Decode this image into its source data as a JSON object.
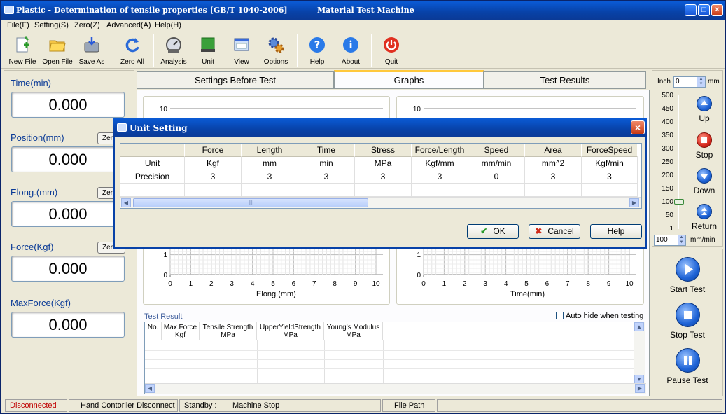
{
  "window": {
    "title_left": "Plastic - Determination of tensile properties [GB/T 1040-2006]",
    "title_center": "Material Test Machine",
    "minimize": "_",
    "maximize": "□",
    "close": "×"
  },
  "menu": [
    "File(F)",
    "Setting(S)",
    "Zero(Z)",
    "Advanced(A)",
    "Help(H)"
  ],
  "toolbar": {
    "new_file": "New File",
    "open_file": "Open File",
    "save_as": "Save As",
    "zero_all": "Zero All",
    "analysis": "Analysis",
    "unit": "Unit",
    "view": "View",
    "options": "Options",
    "help": "Help",
    "about": "About",
    "quit": "Quit"
  },
  "left": {
    "time_label": "Time(min)",
    "time_value": "0.000",
    "position_label": "Position(mm)",
    "position_value": "0.000",
    "elong_label": "Elong.(mm)",
    "elong_value": "0.000",
    "force_label": "Force(Kgf)",
    "force_value": "0.000",
    "maxforce_label": "MaxForce(Kgf)",
    "maxforce_value": "0.000",
    "zero_label": "Zero"
  },
  "tabs": [
    "Settings Before Test",
    "Graphs",
    "Test Results"
  ],
  "graphs": {
    "y_top_tick": "10",
    "y_bottom_ticks": [
      "1",
      "0"
    ],
    "x_ticks": [
      "0",
      "1",
      "2",
      "3",
      "4",
      "5",
      "6",
      "7",
      "8",
      "9",
      "10"
    ],
    "left_xlabel": "Elong.(mm)",
    "right_xlabel": "Time(min)"
  },
  "test_result": {
    "title": "Test Result",
    "auto_hide": "Auto hide when testing",
    "columns": [
      {
        "name": "No.",
        "unit": ""
      },
      {
        "name": "Max.Force",
        "unit": "Kgf"
      },
      {
        "name": "Tensile Strength",
        "unit": "MPa"
      },
      {
        "name": "UpperYieldStrength",
        "unit": "MPa"
      },
      {
        "name": "Young's Modulus",
        "unit": "MPa"
      }
    ]
  },
  "right": {
    "inch_label": "Inch",
    "inch_value": "0",
    "mm_label": "mm",
    "scale": [
      "500",
      "450",
      "400",
      "350",
      "300",
      "250",
      "200",
      "150",
      "100",
      "50",
      "1"
    ],
    "up": "Up",
    "stop": "Stop",
    "down": "Down",
    "return": "Return",
    "speed_value": "100",
    "speed_unit": "mm/min",
    "start_test": "Start Test",
    "stop_test": "Stop Test",
    "pause_test": "Pause Test"
  },
  "status": {
    "connection": "Disconnected",
    "hand_controller": "Hand Contorller Disconnect",
    "standby": "Standby :",
    "machine": "Machine Stop",
    "file_path": "File Path",
    "connection_color": "#c00000"
  },
  "dialog": {
    "title": "Unit Setting",
    "close": "×",
    "headers": [
      "",
      "Force",
      "Length",
      "Time",
      "Stress",
      "Force/Length",
      "Speed",
      "Area",
      "ForceSpeed"
    ],
    "rows": [
      [
        "Unit",
        "Kgf",
        "mm",
        "min",
        "MPa",
        "Kgf/mm",
        "mm/min",
        "mm^2",
        "Kgf/min"
      ],
      [
        "Precision",
        "3",
        "3",
        "3",
        "3",
        "3",
        "0",
        "3",
        "3"
      ],
      [
        "",
        "",
        "",
        "",
        "",
        "",
        "",
        "",
        ""
      ]
    ],
    "ok": "OK",
    "cancel": "Cancel",
    "help": "Help"
  }
}
